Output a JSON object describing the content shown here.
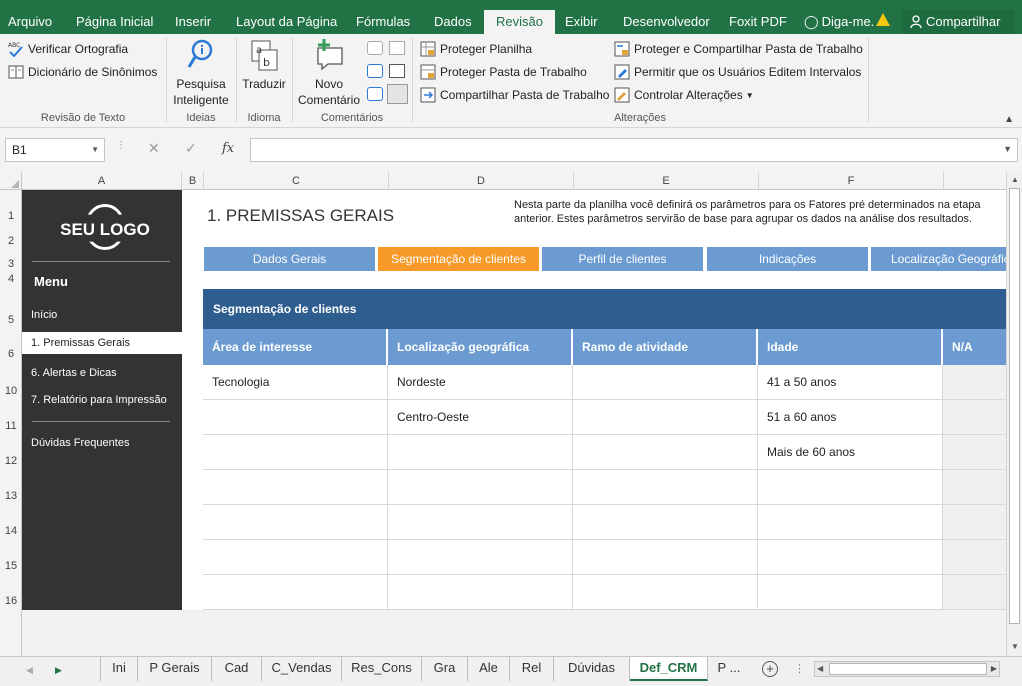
{
  "ribbon_tabs": [
    {
      "label": "Arquivo"
    },
    {
      "label": "Página Inicial"
    },
    {
      "label": "Inserir"
    },
    {
      "label": "Layout da Página"
    },
    {
      "label": "Fórmulas"
    },
    {
      "label": "Dados"
    },
    {
      "label": "Revisão",
      "active": true
    },
    {
      "label": "Exibir"
    },
    {
      "label": "Desenvolvedor"
    },
    {
      "label": "Foxit PDF"
    },
    {
      "label": "Diga-me."
    }
  ],
  "share_label": "Compartilhar",
  "ribbon": {
    "spelling": "Verificar Ortografia",
    "thesaurus": "Dicionário de Sinônimos",
    "group_proofing": "Revisão de Texto",
    "smart_lookup": "Pesquisa Inteligente",
    "group_insights": "Ideias",
    "translate": "Traduzir",
    "group_language": "Idioma",
    "new_comment": "Novo Comentário",
    "group_comments": "Comentários",
    "protect_sheet": "Proteger Planilha",
    "protect_workbook": "Proteger Pasta de Trabalho",
    "share_workbook": "Compartilhar Pasta de Trabalho",
    "protect_share_workbook": "Proteger e Compartilhar Pasta de Trabalho",
    "allow_edit_ranges": "Permitir que os Usuários Editem Intervalos",
    "track_changes": "Controlar Alterações",
    "group_changes": "Alterações"
  },
  "formula_bar": {
    "name_box": "B1",
    "fx": "fx",
    "value": ""
  },
  "columns": [
    "A",
    "B",
    "C",
    "D",
    "E",
    "F"
  ],
  "rows": [
    "1",
    "2",
    "3",
    "4",
    "5",
    "6",
    "10",
    "11",
    "12",
    "13",
    "14",
    "15",
    "16"
  ],
  "sidebar": {
    "logo": "SEU LOGO",
    "menu_title": "Menu",
    "items": [
      {
        "label": "Início"
      },
      {
        "label": "1. Premissas Gerais",
        "active": true
      },
      {
        "label": "6. Alertas e Dicas"
      },
      {
        "label": "7. Relatório para Impressão"
      },
      {
        "label": "Dúvidas Frequentes"
      }
    ]
  },
  "page": {
    "title": "1. PREMISSAS GERAIS",
    "description": "Nesta parte da planilha você definirá os parâmetros para os Fatores pré determinados na etapa anterior. Estes parâmetros servirão de base para agrupar os dados na análise dos resultados."
  },
  "nav_tabs": [
    {
      "label": "Dados Gerais"
    },
    {
      "label": "Segmentação de clientes",
      "active": true
    },
    {
      "label": "Perfil de clientes"
    },
    {
      "label": "Indicações"
    },
    {
      "label": "Localização Geográfica"
    }
  ],
  "table": {
    "title": "Segmentação de clientes",
    "headers": [
      "Área de interesse",
      "Localização geográfica",
      "Ramo de atividade",
      "Idade",
      "N/A"
    ],
    "rows": [
      [
        "Tecnologia",
        "Nordeste",
        "",
        "41 a 50 anos",
        ""
      ],
      [
        "",
        "Centro-Oeste",
        "",
        "51 a 60 anos",
        ""
      ],
      [
        "",
        "",
        "",
        "Mais de 60 anos",
        ""
      ],
      [
        "",
        "",
        "",
        "",
        ""
      ],
      [
        "",
        "",
        "",
        "",
        ""
      ],
      [
        "",
        "",
        "",
        "",
        ""
      ],
      [
        "",
        "",
        "",
        "",
        ""
      ]
    ]
  },
  "sheet_tabs": [
    {
      "label": "Ini"
    },
    {
      "label": "P Gerais"
    },
    {
      "label": "Cad"
    },
    {
      "label": "C_Vendas"
    },
    {
      "label": "Res_Cons"
    },
    {
      "label": "Gra"
    },
    {
      "label": "Ale"
    },
    {
      "label": "Rel"
    },
    {
      "label": "Dúvidas"
    },
    {
      "label": "Def_CRM",
      "active": true
    },
    {
      "label": "P ..."
    }
  ],
  "colors": {
    "excel_green": "#217346",
    "sidebar": "#333333",
    "tab_blue": "#6b9bd1",
    "tab_active": "#f79a2a",
    "table_header": "#2e5d8f"
  }
}
